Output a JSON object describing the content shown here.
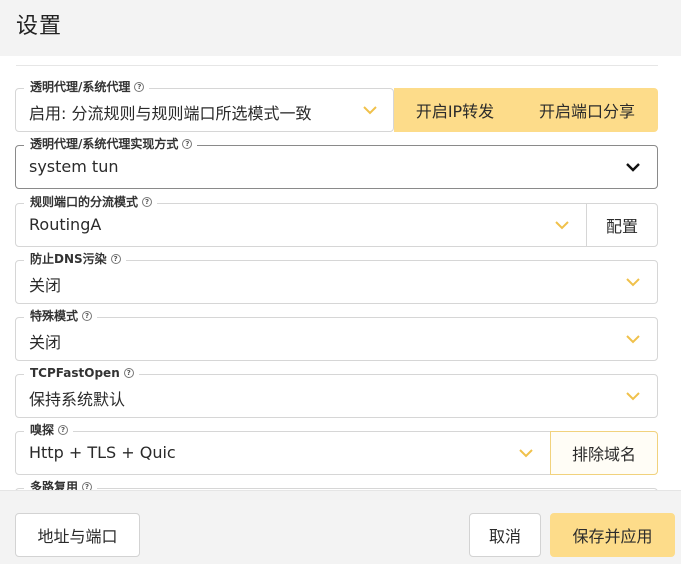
{
  "header": {
    "title": "设置"
  },
  "fields": {
    "transparent_proxy": {
      "label": "透明代理/系统代理",
      "value": "启用: 分流规则与规则端口所选模式一致",
      "btn_ip_forward": "开启IP转发",
      "btn_port_share": "开启端口分享"
    },
    "proxy_impl": {
      "label": "透明代理/系统代理实现方式",
      "value": "system tun"
    },
    "routing_mode": {
      "label": "规则端口的分流模式",
      "value": "RoutingA",
      "btn_config": "配置"
    },
    "dns_pollution": {
      "label": "防止DNS污染",
      "value": "关闭"
    },
    "special_mode": {
      "label": "特殊模式",
      "value": "关闭"
    },
    "tcp_fast_open": {
      "label": "TCPFastOpen",
      "value": "保持系统默认"
    },
    "sniffing": {
      "label": "嗅探",
      "value": "Http + TLS + Quic",
      "btn_exclude": "排除域名"
    },
    "mux": {
      "label": "多路复用"
    }
  },
  "footer": {
    "address_port": "地址与端口",
    "cancel": "取消",
    "save_apply": "保存并应用"
  },
  "colors": {
    "accent_yellow": "#fddc8a",
    "chevron_yellow": "#f0c14b"
  },
  "icons": {
    "help": "help-circle-icon",
    "dropdown": "chevron-down-icon"
  }
}
